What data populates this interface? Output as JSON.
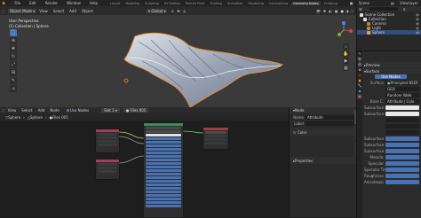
{
  "menu": {
    "items": [
      "File",
      "Edit",
      "Render",
      "Window",
      "Help"
    ],
    "tabs": [
      "Layout",
      "Modeling",
      "Sculpting",
      "UV Editing",
      "Texture Paint",
      "Shading",
      "Animation",
      "Rendering",
      "Compositing",
      "Geometry Nodes",
      "Scripting"
    ],
    "active_tab": "Geometry Nodes",
    "scene": "Scene",
    "view_layer": "ViewLayer"
  },
  "viewport": {
    "mode": "Object Mode",
    "menu": [
      "View",
      "Select",
      "Add",
      "Object"
    ],
    "orientation": "Global",
    "overlay_title": "User Perspective",
    "overlay_subtitle": "(1) Collection | Sphere"
  },
  "node_editor": {
    "header_menu": [
      "View",
      "Select",
      "Add",
      "Node"
    ],
    "use_nodes": "Use Nodes",
    "slot": "Slot 1",
    "material": "Files 005",
    "breadcrumb": [
      "Sphere",
      "Sphere",
      "Files 005"
    ]
  },
  "node_panel": {
    "tab": "Node",
    "name_label": "Name",
    "name_value": "Attribute",
    "label_label": "Label",
    "color_label": "Color",
    "properties_label": "Properties"
  },
  "outliner": {
    "items": [
      {
        "label": "Scene Collection",
        "indent": 0,
        "color": "#e0e0e0",
        "selected": false
      },
      {
        "label": "Collection",
        "indent": 1,
        "color": "#e0e0e0",
        "selected": false
      },
      {
        "label": "Camera",
        "indent": 2,
        "color": "#c2823b",
        "selected": false
      },
      {
        "label": "Light",
        "indent": 2,
        "color": "#c2823b",
        "selected": false
      },
      {
        "label": "Sphere",
        "indent": 2,
        "color": "#e3a04b",
        "selected": true
      }
    ]
  },
  "properties": {
    "preview": "Preview",
    "surface_section": "Surface",
    "use_nodes": "Use Nodes",
    "surface_label": "Surface",
    "surface_value": "Principled BSDF",
    "rows": [
      {
        "label": "",
        "value": "GGX",
        "style": "dark"
      },
      {
        "label": "",
        "value": "Random Walk",
        "style": "dark"
      },
      {
        "label": "Base C.",
        "value": "Attribute | Colo",
        "style": "dark"
      },
      {
        "label": "Subsurface",
        "value": "",
        "style": "white"
      },
      {
        "label": "Subsurface",
        "value": "",
        "style": "white"
      },
      {
        "label": "",
        "value": "",
        "style": "dark"
      },
      {
        "label": "",
        "value": "",
        "style": "dark"
      },
      {
        "label": "",
        "value": "",
        "style": "dark"
      },
      {
        "label": "Subsurface",
        "value": "",
        "style": "blue"
      },
      {
        "label": "Subsurface",
        "value": "",
        "style": "blue"
      },
      {
        "label": "Subsurface",
        "value": "",
        "style": "blue"
      },
      {
        "label": "Metallic",
        "value": "",
        "style": "blue"
      },
      {
        "label": "Specular",
        "value": "",
        "style": "blue"
      },
      {
        "label": "Specular Tint",
        "value": "",
        "style": "blue"
      },
      {
        "label": "Roughness",
        "value": "",
        "style": "blue"
      },
      {
        "label": "Anisotropic",
        "value": "",
        "style": "blue"
      }
    ]
  }
}
